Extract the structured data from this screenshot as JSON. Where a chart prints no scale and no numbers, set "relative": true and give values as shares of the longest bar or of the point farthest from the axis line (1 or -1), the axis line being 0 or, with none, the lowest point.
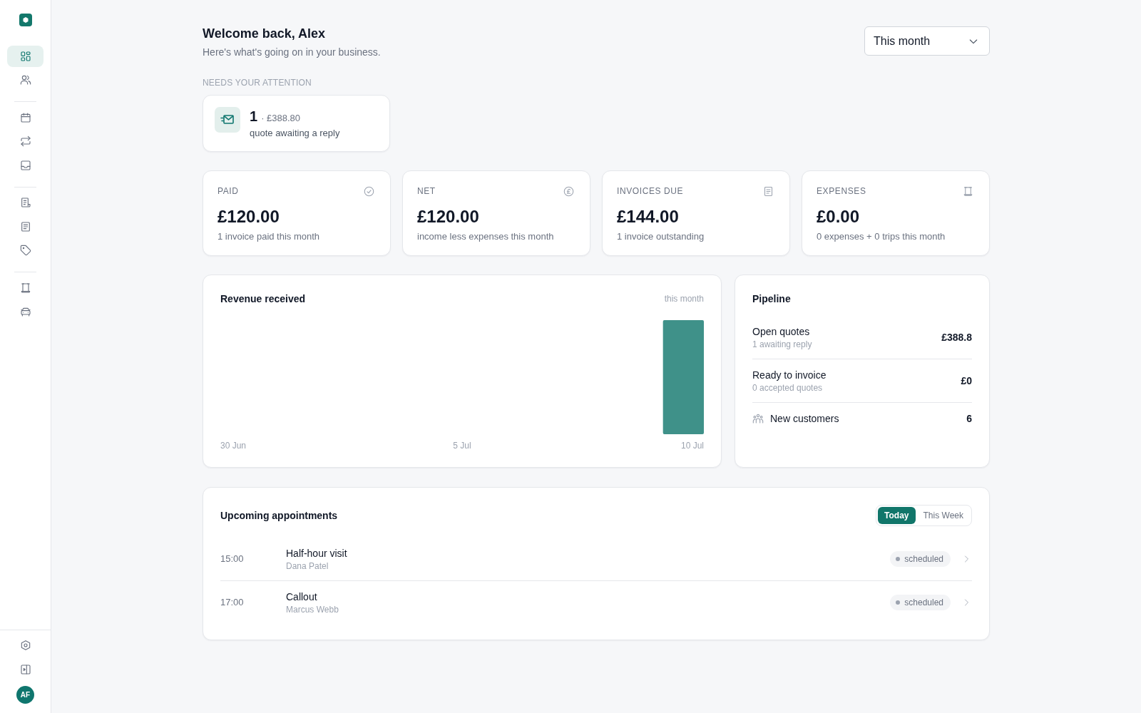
{
  "sidebar": {
    "nav_groups": [
      {
        "items": [
          {
            "selected": true
          },
          {
            "selected": false
          }
        ]
      },
      {
        "items": [
          {
            "selected": false
          },
          {
            "selected": false
          },
          {
            "selected": false
          }
        ]
      },
      {
        "items": [
          {
            "selected": false
          },
          {
            "selected": false
          },
          {
            "selected": false
          }
        ]
      },
      {
        "items": [
          {
            "selected": false
          },
          {
            "selected": false
          }
        ]
      }
    ],
    "avatar": "AF"
  },
  "header": {
    "title": "Welcome back, Alex",
    "subtitle": "Here's what's going on in your business.",
    "period_select": "This month"
  },
  "attention": {
    "heading": "NEEDS YOUR ATTENTION",
    "items": [
      {
        "count": "1",
        "amount": "· £388.80",
        "label": "quote awaiting a reply"
      }
    ]
  },
  "stats": [
    {
      "label": "PAID",
      "value": "£120.00",
      "note": "1 invoice paid this month"
    },
    {
      "label": "NET",
      "value": "£120.00",
      "note": "income less expenses this month"
    },
    {
      "label": "INVOICES DUE",
      "value": "£144.00",
      "note": "1 invoice outstanding"
    },
    {
      "label": "EXPENSES",
      "value": "£0.00",
      "note": "0 expenses + 0 trips this month"
    }
  ],
  "revenue": {
    "period": "this month",
    "chart_data": {
      "type": "bar",
      "title": "Revenue received",
      "relative": true,
      "categories": [
        "30 Jun",
        null,
        null,
        null,
        null,
        "5 Jul",
        null,
        null,
        null,
        null,
        "10 Jul"
      ],
      "values": [
        0,
        0,
        0,
        0,
        0,
        0,
        0,
        0,
        0,
        0,
        1
      ]
    }
  },
  "pipeline": {
    "title": "Pipeline",
    "rows": [
      {
        "kind": "detail",
        "label": "Open quotes",
        "note": "1 awaiting reply",
        "value": "£388.8"
      },
      {
        "kind": "detail",
        "label": "Ready to invoice",
        "note": "0 accepted quotes",
        "value": "£0"
      },
      {
        "kind": "icon",
        "label": "New customers",
        "value": "6"
      }
    ]
  },
  "appointments": {
    "title": "Upcoming appointments",
    "tabs": [
      {
        "label": "Today",
        "selected": true
      },
      {
        "label": "This Week",
        "selected": false
      }
    ],
    "rows": [
      {
        "time": "15:00",
        "title": "Half-hour visit",
        "customer": "Dana Patel",
        "status": "scheduled"
      },
      {
        "time": "17:00",
        "title": "Callout",
        "customer": "Marcus Webb",
        "status": "scheduled"
      }
    ]
  }
}
